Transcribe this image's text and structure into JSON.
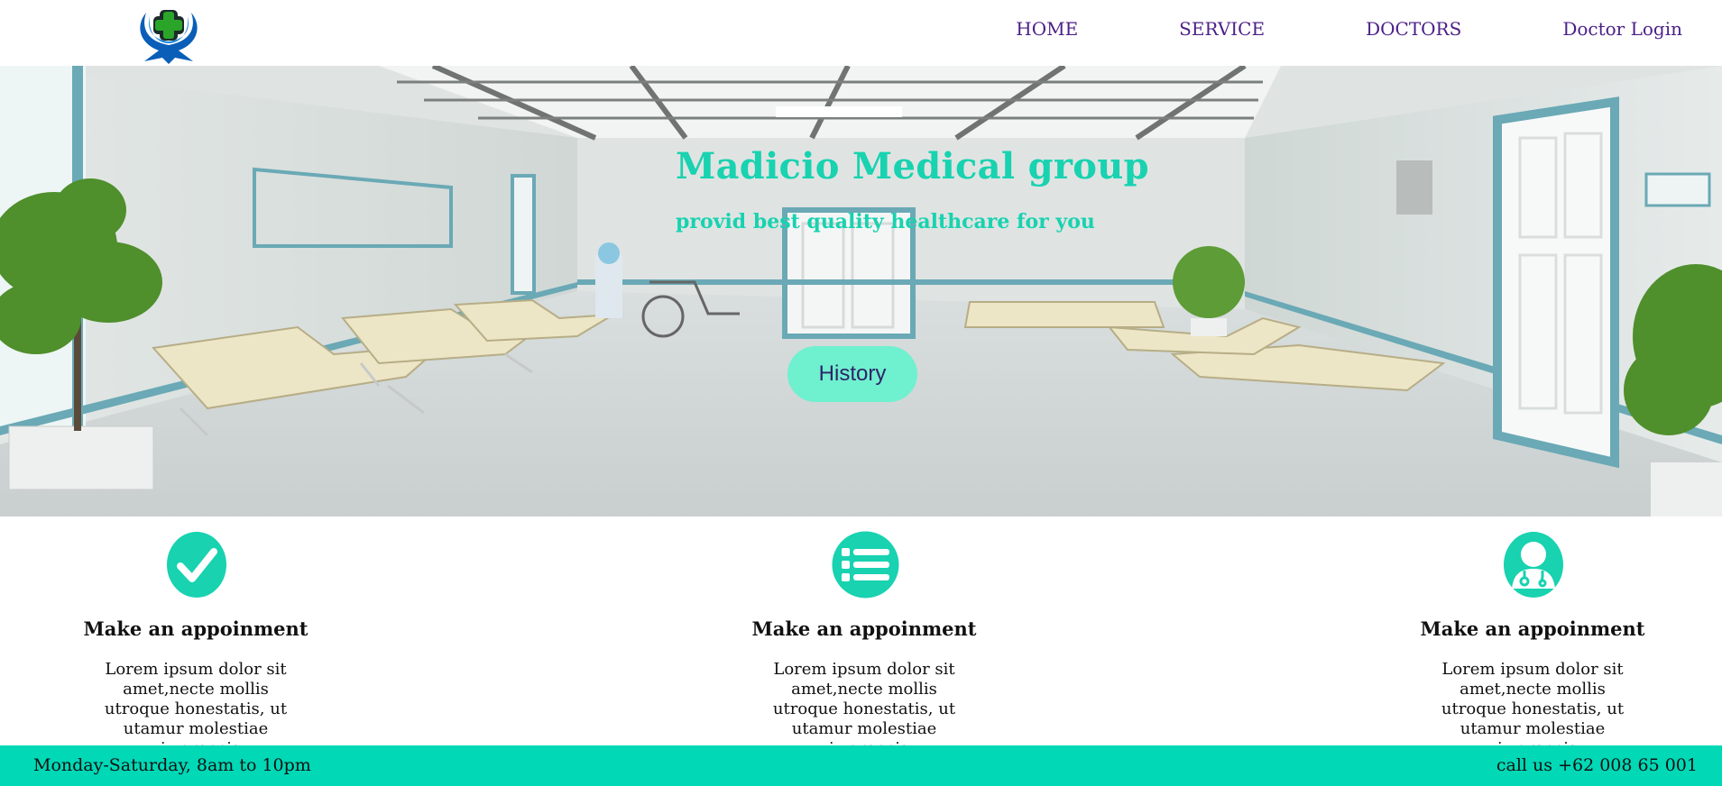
{
  "nav": {
    "items": [
      {
        "label": "HOME"
      },
      {
        "label": "SERVICE"
      },
      {
        "label": "DOCTORS"
      },
      {
        "label": "Doctor Login"
      }
    ]
  },
  "hero": {
    "title": "Madicio Medical group",
    "subtitle": "provid best quality healthcare for you",
    "button_label": "History"
  },
  "features": [
    {
      "icon": "check-circle-icon",
      "title": "Make an appoinment",
      "text": "Lorem ipsum dolor sit amet,necte mollis utroque honestatis, ut utamur molestiae vix,graecis"
    },
    {
      "icon": "list-icon",
      "title": "Make an appoinment",
      "text": "Lorem ipsum dolor sit amet,necte mollis utroque honestatis, ut utamur molestiae vix,graecis"
    },
    {
      "icon": "doctor-icon",
      "title": "Make an appoinment",
      "text": "Lorem ipsum dolor sit amet,necte mollis utroque honestatis, ut utamur molestiae vix,graecis"
    }
  ],
  "footer": {
    "hours": "Monday-Saturday, 8am to 10pm",
    "phone": "call us +62 008 65 001"
  },
  "colors": {
    "accent": "#00d8b6",
    "hero_text": "#18d2b0",
    "nav_text": "#4b1f87",
    "button_bg": "#6ff0cf",
    "button_text": "#2f2466"
  }
}
